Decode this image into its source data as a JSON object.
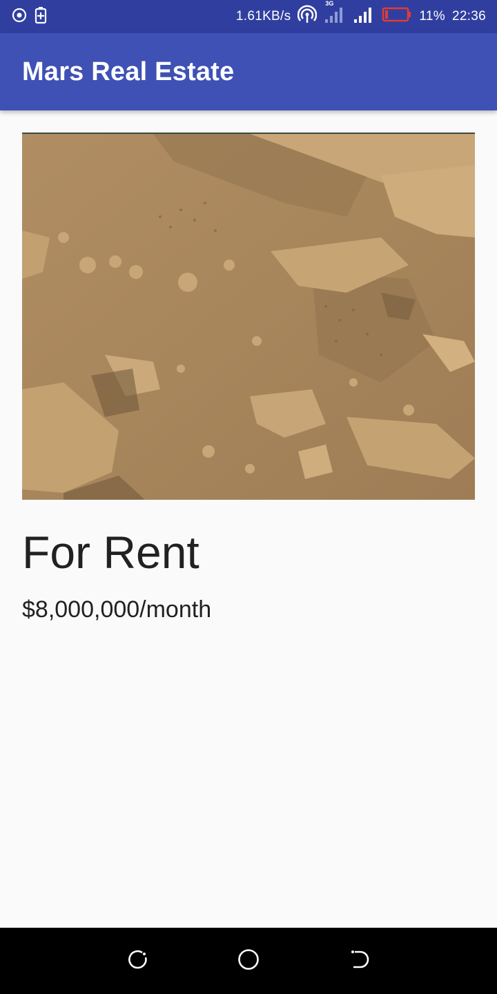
{
  "status_bar": {
    "network_speed": "1.61KB/s",
    "network_type": "3G",
    "battery_percent": "11%",
    "time": "22:36",
    "icons": [
      "location-icon",
      "battery-saver-icon",
      "hotspot-icon",
      "signal-3g-icon",
      "signal-icon",
      "battery-low-icon"
    ]
  },
  "app_bar": {
    "title": "Mars Real Estate"
  },
  "property": {
    "type_label": "For Rent",
    "price_label": "$8,000,000/month",
    "image": "mars-terrain-photo"
  },
  "nav_bar": {
    "icons": [
      "recent-apps-icon",
      "home-icon",
      "back-icon"
    ]
  },
  "colors": {
    "status_bar": "#303f9f",
    "app_bar": "#3f51b5",
    "background": "#fafafa",
    "battery_low": "#e53935"
  }
}
